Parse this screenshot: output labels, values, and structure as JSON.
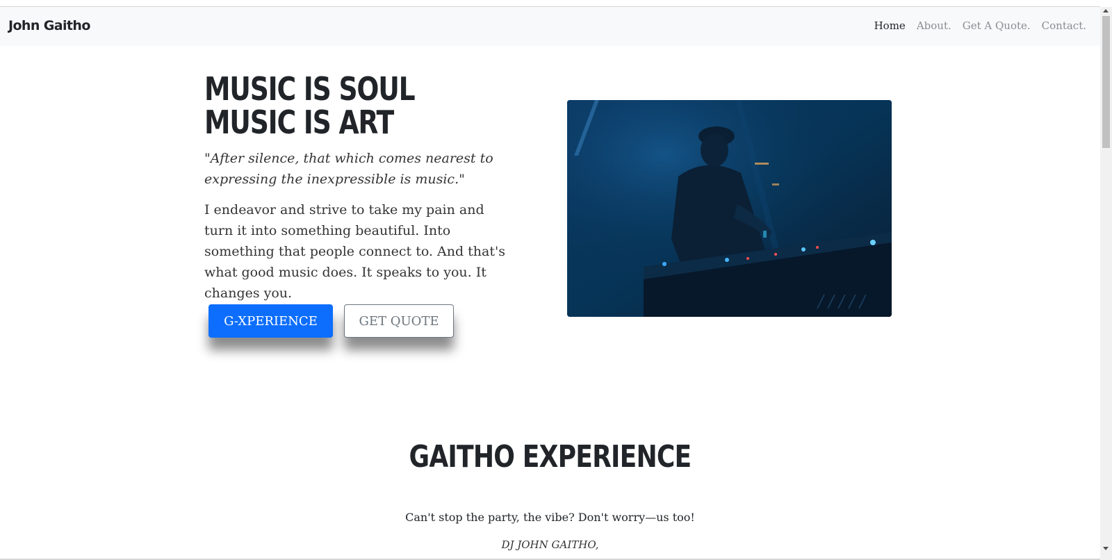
{
  "navbar": {
    "brand": "John Gaitho",
    "links": [
      {
        "label": "Home",
        "active": true
      },
      {
        "label": "About.",
        "active": false
      },
      {
        "label": "Get A Quote.",
        "active": false
      },
      {
        "label": "Contact.",
        "active": false
      }
    ]
  },
  "hero": {
    "title_line1": "MUSIC IS SOUL",
    "title_line2": "MUSIC IS ART",
    "quote": "\"After silence, that which comes nearest to expressing the inexpressible is music.\"",
    "lead": "I endeavor and strive to take my pain and turn it into something beautiful. Into something that people connect to. And that's what good music does. It speaks to you. It changes you.",
    "primary_button": "G-XPERIENCE",
    "secondary_button": "GET QUOTE",
    "image_icon": "dj-performer-photo"
  },
  "experience": {
    "title": "GAITHO EXPERIENCE",
    "text": "Can't stop the party, the vibe? Don't worry—us too!",
    "signature": "DJ JOHN GAITHO,"
  },
  "colors": {
    "primary": "#0d6efd",
    "navbar_bg": "#f8f9fa",
    "text": "#212529",
    "muted": "#6c757d"
  }
}
